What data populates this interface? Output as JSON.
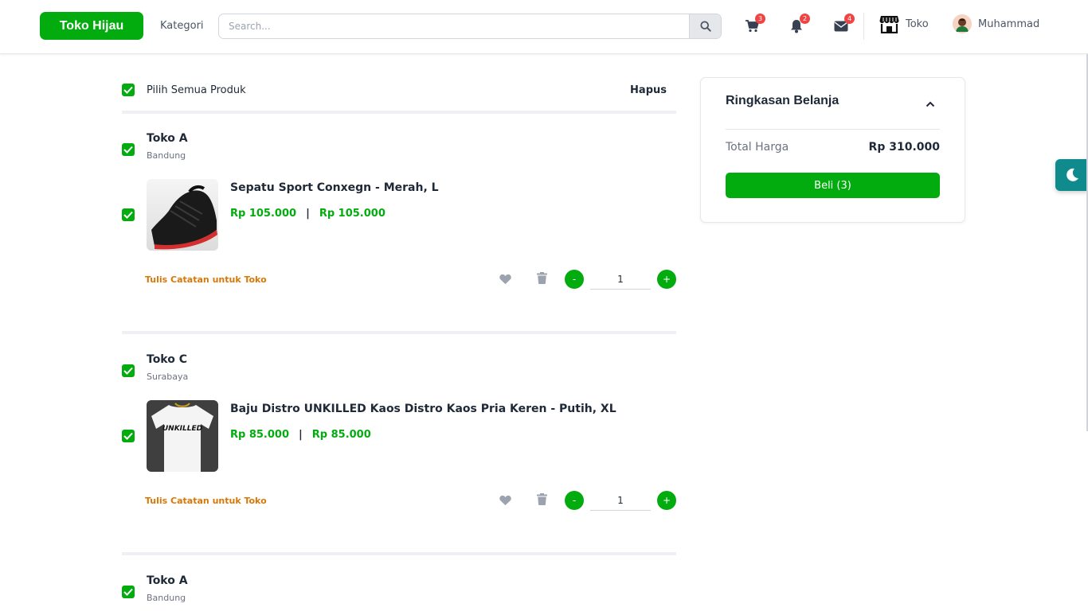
{
  "header": {
    "brand": "Toko Hijau",
    "kategori": "Kategori",
    "search_placeholder": "Search...",
    "cart_badge": "3",
    "notif_badge": "2",
    "mail_badge": "4",
    "toko_label": "Toko",
    "user_name": "Muhammad"
  },
  "cart": {
    "select_all_label": "Pilih Semua Produk",
    "delete_label": "Hapus",
    "stores": [
      {
        "name": "Toko A",
        "city": "Bandung",
        "product": {
          "name": "Sepatu Sport Conxegn - Merah, L",
          "price": "Rp 105.000",
          "price_total": "Rp 105.000",
          "separator": "|",
          "image": "black-sneaker"
        },
        "note_label": "Tulis Catatan untuk Toko",
        "qty": "1",
        "minus": "-",
        "plus": "+"
      },
      {
        "name": "Toko C",
        "city": "Surabaya",
        "product": {
          "name": "Baju Distro UNKILLED Kaos Distro Kaos Pria Keren - Putih, XL",
          "price": "Rp 85.000",
          "price_total": "Rp 85.000",
          "separator": "|",
          "image": "white-tshirt",
          "print_text": "UNKILLED"
        },
        "note_label": "Tulis Catatan untuk Toko",
        "qty": "1",
        "minus": "-",
        "plus": "+"
      },
      {
        "name": "Toko A",
        "city": "Bandung"
      }
    ]
  },
  "summary": {
    "title": "Ringkasan Belanja",
    "total_label": "Total Harga",
    "total_value": "Rp 310.000",
    "buy_label": "Beli (3)"
  },
  "colors": {
    "primary": "#03ac0e",
    "note": "#d97706",
    "badge": "#ef4444",
    "toggle": "#0f8b8d"
  }
}
